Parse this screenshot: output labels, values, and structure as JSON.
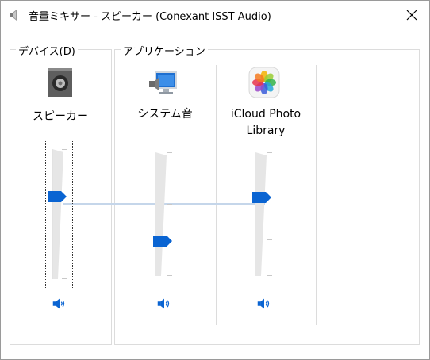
{
  "window": {
    "title": "音量ミキサー - スピーカー (Conexant ISST Audio)",
    "title_icon": "speaker-icon",
    "close_icon": "close-icon"
  },
  "device_group": {
    "label": "デバイス(D)",
    "label_text": "デバイス(",
    "label_accel": "D",
    "label_close": ")",
    "channel": {
      "name": "スピーカー",
      "icon": "speaker-device-icon",
      "volume_percent": 65,
      "mute_icon": "speaker-volume-icon"
    }
  },
  "apps_group": {
    "label": "アプリケーション",
    "channels": [
      {
        "name": "システム音",
        "icon": "system-sounds-icon",
        "volume_percent": 26,
        "mute_icon": "speaker-volume-icon"
      },
      {
        "name_line1": "iCloud Photo",
        "name_line2": "Library",
        "icon": "photos-app-icon",
        "volume_percent": 65,
        "mute_icon": "speaker-volume-icon"
      }
    ]
  },
  "colors": {
    "accent": "#0a64d2",
    "track": "#e6e6e6",
    "link_line": "#c5d6ea"
  }
}
